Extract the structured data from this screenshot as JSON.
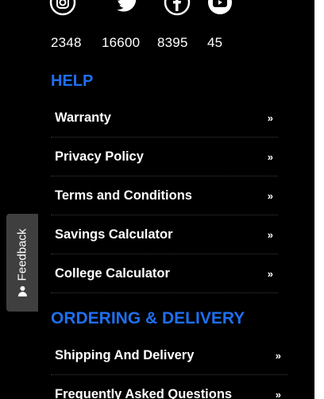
{
  "social": {
    "icons": [
      "instagram-icon",
      "twitter-icon",
      "facebook-icon",
      "youtube-icon"
    ],
    "counts": [
      "2348",
      "16600",
      "8395",
      "45"
    ]
  },
  "help": {
    "title": "HELP",
    "items": [
      {
        "label": "Warranty",
        "arrow": "»"
      },
      {
        "label": "Privacy Policy",
        "arrow": "»"
      },
      {
        "label": "Terms and Conditions",
        "arrow": "»"
      },
      {
        "label": "Savings Calculator",
        "arrow": "»"
      },
      {
        "label": "College Calculator",
        "arrow": "»"
      }
    ]
  },
  "ordering": {
    "title": "ORDERING & DELIVERY",
    "items": [
      {
        "label": "Shipping And Delivery",
        "arrow": "»"
      },
      {
        "label": "Frequently Asked Questions",
        "arrow": "»"
      }
    ]
  },
  "feedback": {
    "label": "Feedback"
  },
  "colors": {
    "background": "#000000",
    "accent": "#1f6ff0",
    "text": "#ffffff",
    "feedback_tab": "#3f3f3f"
  }
}
